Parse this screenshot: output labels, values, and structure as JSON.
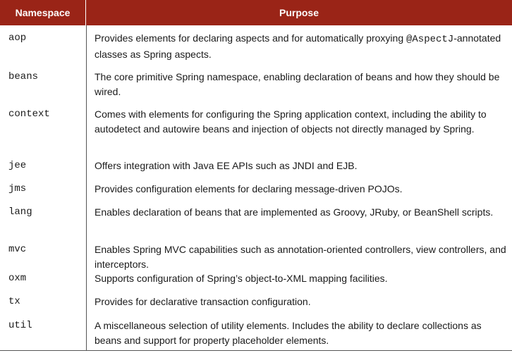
{
  "header": {
    "namespace": "Namespace",
    "purpose": "Purpose"
  },
  "rows": [
    {
      "namespace": "aop",
      "purpose_pre": "Provides elements for declaring aspects and for automatically proxying ",
      "purpose_code": "@AspectJ",
      "purpose_post": "-annotated classes as Spring aspects."
    },
    {
      "namespace": "beans",
      "purpose": "The core primitive Spring namespace, enabling declaration of beans and how they should be wired."
    },
    {
      "namespace": "context",
      "purpose": "Comes with elements for configuring the Spring application context, including the ability to autodetect and autowire beans and injection of objects not directly managed by Spring."
    },
    {
      "namespace": "jee",
      "purpose": "Offers integration with Java EE APIs such as JNDI and EJB."
    },
    {
      "namespace": "jms",
      "purpose": "Provides configuration elements for declaring message-driven POJOs."
    },
    {
      "namespace": "lang",
      "purpose": "Enables declaration of beans that are implemented as Groovy, JRuby, or BeanShell scripts."
    },
    {
      "namespace": "mvc",
      "purpose": "Enables Spring MVC capabilities such as annotation-oriented controllers, view controllers, and interceptors."
    },
    {
      "namespace": "oxm",
      "purpose": "Supports configuration of Spring’s object-to-XML mapping facilities."
    },
    {
      "namespace": "tx",
      "purpose": "Provides for declarative transaction configuration."
    },
    {
      "namespace": "util",
      "purpose": "A miscellaneous selection of utility elements. Includes the ability to declare collections as beans and support for property placeholder elements."
    }
  ]
}
